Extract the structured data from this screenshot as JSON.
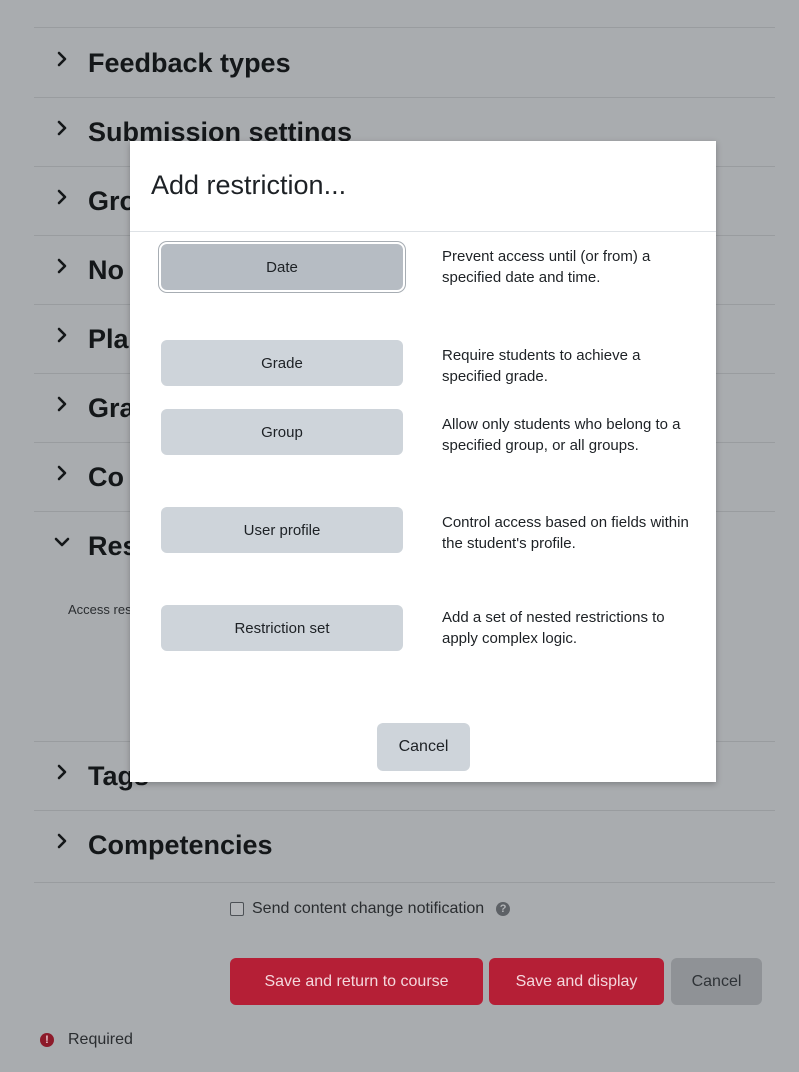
{
  "sections": [
    {
      "title": "Feedback types",
      "expanded": false
    },
    {
      "title": "Submission settings",
      "expanded": false
    },
    {
      "title": "Gro",
      "expanded": false
    },
    {
      "title": "No",
      "expanded": false
    },
    {
      "title": "Pla",
      "expanded": false
    },
    {
      "title": "Gra",
      "expanded": false
    },
    {
      "title": "Co",
      "expanded": false
    },
    {
      "title": "Res",
      "expanded": true
    },
    {
      "title": "Tags",
      "expanded": false
    },
    {
      "title": "Competencies",
      "expanded": false
    }
  ],
  "restrict_access_text": "Access restricti",
  "notification": {
    "label": "Send content change notification",
    "checked": false,
    "help_icon": "question-circle-icon"
  },
  "footer_buttons": {
    "save_return": "Save and return to course",
    "save_display": "Save and display",
    "cancel": "Cancel"
  },
  "required_label": "Required",
  "modal": {
    "title": "Add restriction...",
    "options": [
      {
        "label": "Date",
        "description": "Prevent access until (or from) a specified date and time."
      },
      {
        "label": "Grade",
        "description": "Require students to achieve a specified grade."
      },
      {
        "label": "Group",
        "description": "Allow only students who belong to a specified group, or all groups."
      },
      {
        "label": "User profile",
        "description": "Control access based on fields within the student's profile."
      },
      {
        "label": "Restriction set",
        "description": "Add a set of nested restrictions to apply complex logic."
      }
    ],
    "cancel_label": "Cancel"
  },
  "colors": {
    "primary": "#b51f36",
    "overlay": "#a9acaf",
    "modal_button": "#ced4da"
  }
}
